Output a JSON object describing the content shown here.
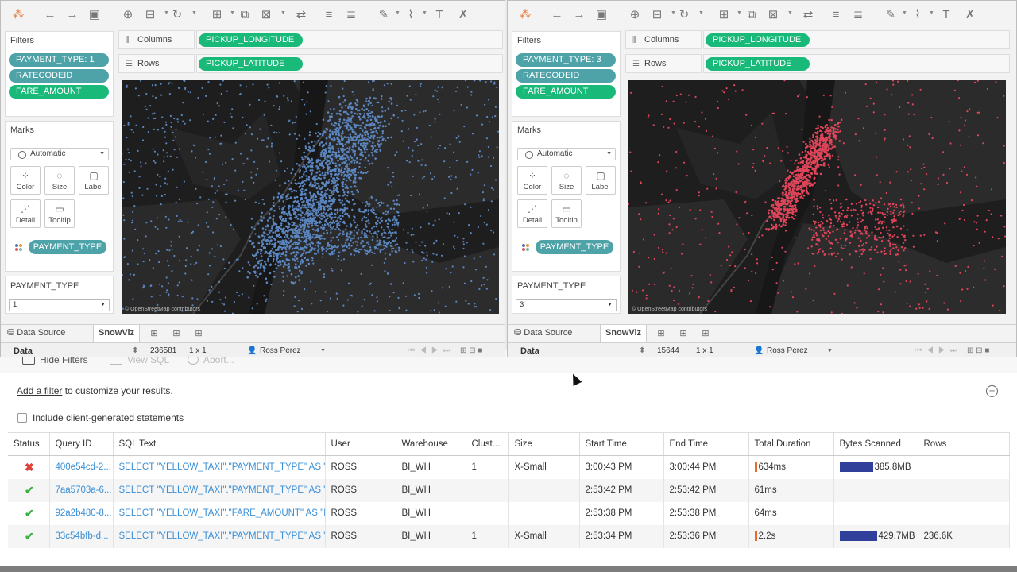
{
  "history": {
    "toolbar": {
      "hide_filters": "Hide Filters",
      "view_sql": "View SQL",
      "abort": "Abort..."
    },
    "add_filter_link": "Add a filter",
    "add_filter_rest": " to customize your results.",
    "include_client": "Include client-generated statements",
    "columns": [
      "Status",
      "Query ID",
      "SQL Text",
      "User",
      "Warehouse",
      "Clust...",
      "Size",
      "Start Time",
      "End Time",
      "Total Duration",
      "Bytes Scanned",
      "Rows"
    ],
    "rows": [
      {
        "status": "error",
        "id": "400e54cd-2...",
        "sql": "SELECT \"YELLOW_TAXI\".\"PAYMENT_TYPE\" AS \"P...",
        "user": "ROSS",
        "wh": "BI_WH",
        "clust": "1",
        "size": "X-Small",
        "start": "3:00:43 PM",
        "end": "3:00:44 PM",
        "duration": "634ms",
        "dur_bar": true,
        "bytes": "385.8MB",
        "bytes_fraction": 0.9,
        "rows": ""
      },
      {
        "status": "ok",
        "id": "7aa5703a-6...",
        "sql": "SELECT \"YELLOW_TAXI\".\"PAYMENT_TYPE\" AS \"P...",
        "user": "ROSS",
        "wh": "BI_WH",
        "clust": "",
        "size": "",
        "start": "2:53:42 PM",
        "end": "2:53:42 PM",
        "duration": "61ms",
        "dur_bar": false,
        "bytes": "",
        "bytes_fraction": 0,
        "rows": ""
      },
      {
        "status": "ok",
        "id": "92a2b480-8...",
        "sql": "SELECT \"YELLOW_TAXI\".\"FARE_AMOUNT\" AS \"F...",
        "user": "ROSS",
        "wh": "BI_WH",
        "clust": "",
        "size": "",
        "start": "2:53:38 PM",
        "end": "2:53:38 PM",
        "duration": "64ms",
        "dur_bar": false,
        "bytes": "",
        "bytes_fraction": 0,
        "rows": ""
      },
      {
        "status": "ok",
        "id": "33c54bfb-d...",
        "sql": "SELECT \"YELLOW_TAXI\".\"PAYMENT_TYPE\" AS \"P...",
        "user": "ROSS",
        "wh": "BI_WH",
        "clust": "1",
        "size": "X-Small",
        "start": "2:53:34 PM",
        "end": "2:53:36 PM",
        "duration": "2.2s",
        "dur_bar": true,
        "bytes": "429.7MB",
        "bytes_fraction": 1.0,
        "rows": "236.6K"
      }
    ]
  },
  "windows": [
    {
      "filters_title": "Filters",
      "filters": [
        {
          "label": "PAYMENT_TYPE: 1",
          "color": "teal"
        },
        {
          "label": "RATECODEID",
          "color": "teal"
        },
        {
          "label": "FARE_AMOUNT",
          "color": "green"
        }
      ],
      "columns_label": "Columns",
      "rows_label": "Rows",
      "columns_pill": "PICKUP_LONGITUDE",
      "rows_pill": "PICKUP_LATITUDE",
      "marks_title": "Marks",
      "mark_type": "Automatic",
      "mark_buttons": [
        "Color",
        "Size",
        "Label",
        "Detail",
        "Tooltip"
      ],
      "color_pill": "PAYMENT_TYPE",
      "qf_title": "PAYMENT_TYPE",
      "qf_value": "1",
      "map_credit": "© OpenStreetMap contributors",
      "dot_color": "#5b86c0",
      "tab_data_source": "Data Source",
      "tab_sheet": "SnowViz",
      "status_ds": "Data",
      "status_count": "236581",
      "status_dims": "1 x 1",
      "status_user": "Ross Perez"
    },
    {
      "filters_title": "Filters",
      "filters": [
        {
          "label": "PAYMENT_TYPE: 3",
          "color": "teal"
        },
        {
          "label": "RATECODEID",
          "color": "teal"
        },
        {
          "label": "FARE_AMOUNT",
          "color": "green"
        }
      ],
      "columns_label": "Columns",
      "rows_label": "Rows",
      "columns_pill": "PICKUP_LONGITUDE",
      "rows_pill": "PICKUP_LATITUDE",
      "marks_title": "Marks",
      "mark_type": "Automatic",
      "mark_buttons": [
        "Color",
        "Size",
        "Label",
        "Detail",
        "Tooltip"
      ],
      "color_pill": "PAYMENT_TYPE",
      "qf_title": "PAYMENT_TYPE",
      "qf_value": "3",
      "map_credit": "© OpenStreetMap contributors",
      "dot_color": "#e0455a",
      "tab_data_source": "Data Source",
      "tab_sheet": "SnowViz",
      "status_ds": "Data",
      "status_count": "15644",
      "status_dims": "1 x 1",
      "status_user": "Ross Perez"
    }
  ]
}
